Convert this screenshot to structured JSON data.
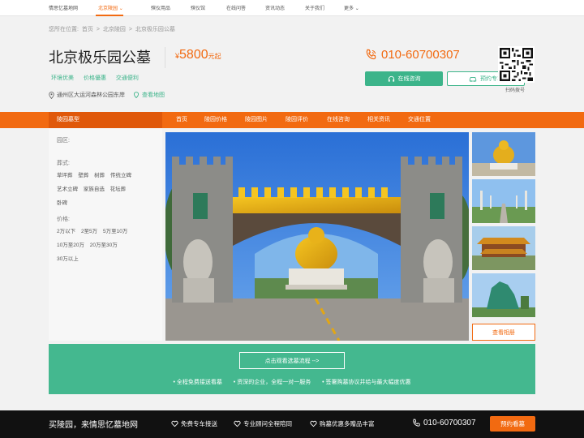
{
  "topnav": {
    "items": [
      "情思忆墓地网",
      "北京陵园",
      "殡仪用品",
      "殡仪馆",
      "在线问答",
      "资讯动态",
      "关于我们",
      "更多"
    ]
  },
  "breadcrumb": [
    "您所在位置:",
    "首页",
    ">",
    "北京陵园",
    ">",
    "北京极乐园公墓"
  ],
  "header": {
    "title": "北京极乐园公墓",
    "price_currency": "¥",
    "price_value": "5800",
    "price_unit": "元起",
    "tags": [
      "环境优美",
      "价格優惠",
      "交通便利"
    ],
    "address": "通州区大运河森林公园东岸",
    "map_link": "查看地图",
    "phone": "010-60700307",
    "consult_button": "在线咨询",
    "car_button": "预约专车",
    "qr_label": "扫码拨号"
  },
  "orange_nav": {
    "category": "陵园墓型",
    "links": [
      "首页",
      "陵园价格",
      "陵园图片",
      "陵园评价",
      "在线咨询",
      "相关资讯",
      "交通位置"
    ]
  },
  "filter": {
    "area_label": "园区:",
    "type_label": "葬式:",
    "type_options": [
      "草坪葬",
      "壁葬",
      "树葬",
      "传统立碑",
      "艺术立碑",
      "家族自选",
      "花坛葬",
      "卧碑"
    ],
    "price_label": "价格:",
    "price_options": [
      "2万以下",
      "2至5万",
      "5万至10万",
      "10万至20万",
      "20万至30万",
      "30万以上"
    ]
  },
  "album_button": "查看相册",
  "banner": {
    "flow_button": "点击观看选墓流程 -->",
    "benefits": [
      "• 全程免费接送看墓",
      "• 资深的企业，全程一对一服务",
      "• 签署购墓协议并给与最大幅度优惠"
    ]
  },
  "footer": {
    "slogan": "买陵园，来情思忆墓地网",
    "features": [
      "免费专车接送",
      "专业顾问全程陪同",
      "购墓优惠多赠品丰富"
    ],
    "phone": "010-60700307",
    "book_button": "预约看墓"
  },
  "colors": {
    "accent": "#f26a11",
    "green": "#3cb48a",
    "banner_green": "#44b88f",
    "footer": "#111111"
  }
}
